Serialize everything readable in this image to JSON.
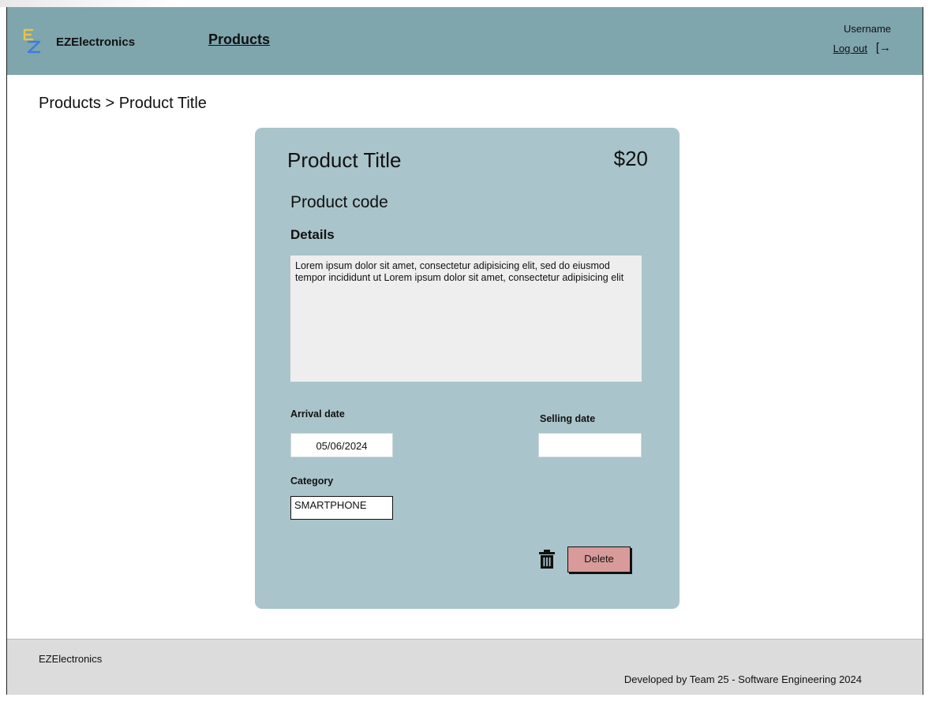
{
  "header": {
    "brand": "EZElectronics",
    "nav_products": "Products",
    "username": "Username",
    "logout": "Log out",
    "logout_icon": "[→"
  },
  "breadcrumb": "Products > Product Title",
  "product": {
    "title": "Product Title",
    "price": "$20",
    "code": "Product code",
    "details_heading": "Details",
    "details_text": "Lorem ipsum dolor sit amet, consectetur adipisicing elit, sed do eiusmod tempor incididunt ut Lorem ipsum dolor sit amet, consectetur adipisicing elit",
    "arrival_label": "Arrival date",
    "arrival_value": "05/06/2024",
    "selling_label": "Selling date",
    "selling_value": "",
    "category_label": "Category",
    "category_value": "SMARTPHONE",
    "delete_label": "Delete"
  },
  "footer": {
    "brand": "EZElectronics",
    "credit": "Developed by Team 25 - Software Engineering 2024"
  },
  "colors": {
    "topbar": "#7fa5ad",
    "card": "#a9c4ca",
    "delete_button": "#d99a9a",
    "footer": "#dcdcdc"
  },
  "icons": {
    "logo": "ez-logo-icon",
    "logout": "logout-icon",
    "delete": "trash-icon"
  }
}
